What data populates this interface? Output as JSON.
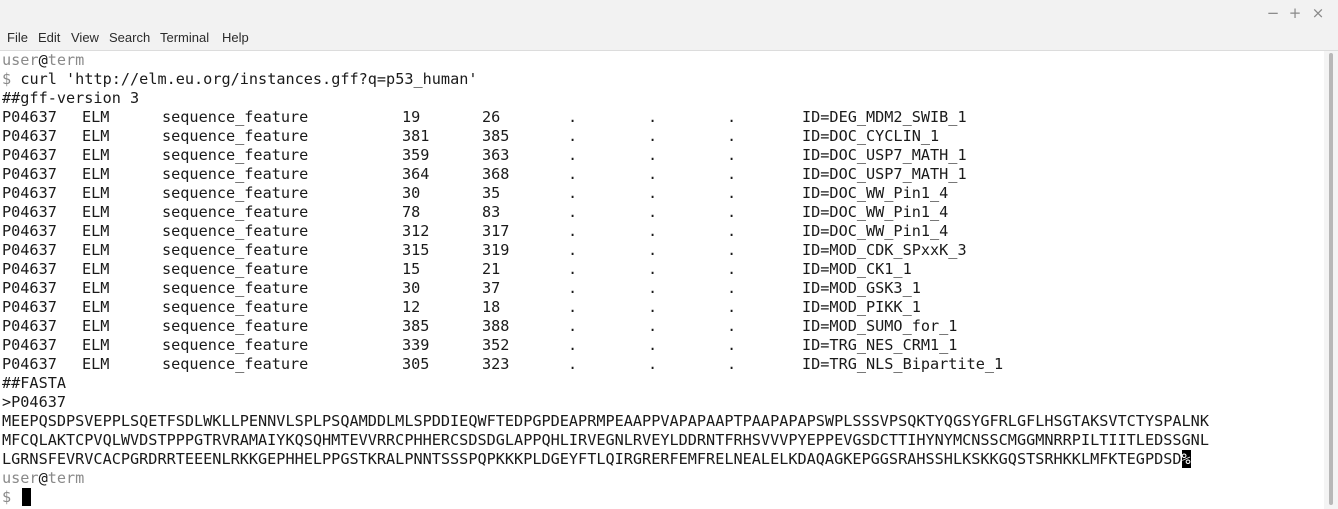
{
  "window": {
    "controls": {
      "minimize": "−",
      "maximize": "+",
      "close": "×"
    }
  },
  "menu": [
    "File",
    "Edit",
    "View",
    "Search",
    "Terminal",
    "Help"
  ],
  "terminal": {
    "prompt_user": "user",
    "prompt_at": "@",
    "prompt_host": "term",
    "prompt_symbol": "$",
    "command": "curl 'http://elm.eu.org/instances.gff?q=p53_human'",
    "gff_header": "##gff-version 3",
    "gff_rows": [
      {
        "seqid": "P04637",
        "source": "ELM",
        "type": "sequence_feature",
        "start": "19",
        "end": "26",
        "score": ".",
        "strand": ".",
        "phase": ".",
        "attr": "ID=DEG_MDM2_SWIB_1"
      },
      {
        "seqid": "P04637",
        "source": "ELM",
        "type": "sequence_feature",
        "start": "381",
        "end": "385",
        "score": ".",
        "strand": ".",
        "phase": ".",
        "attr": "ID=DOC_CYCLIN_1"
      },
      {
        "seqid": "P04637",
        "source": "ELM",
        "type": "sequence_feature",
        "start": "359",
        "end": "363",
        "score": ".",
        "strand": ".",
        "phase": ".",
        "attr": "ID=DOC_USP7_MATH_1"
      },
      {
        "seqid": "P04637",
        "source": "ELM",
        "type": "sequence_feature",
        "start": "364",
        "end": "368",
        "score": ".",
        "strand": ".",
        "phase": ".",
        "attr": "ID=DOC_USP7_MATH_1"
      },
      {
        "seqid": "P04637",
        "source": "ELM",
        "type": "sequence_feature",
        "start": "30",
        "end": "35",
        "score": ".",
        "strand": ".",
        "phase": ".",
        "attr": "ID=DOC_WW_Pin1_4"
      },
      {
        "seqid": "P04637",
        "source": "ELM",
        "type": "sequence_feature",
        "start": "78",
        "end": "83",
        "score": ".",
        "strand": ".",
        "phase": ".",
        "attr": "ID=DOC_WW_Pin1_4"
      },
      {
        "seqid": "P04637",
        "source": "ELM",
        "type": "sequence_feature",
        "start": "312",
        "end": "317",
        "score": ".",
        "strand": ".",
        "phase": ".",
        "attr": "ID=DOC_WW_Pin1_4"
      },
      {
        "seqid": "P04637",
        "source": "ELM",
        "type": "sequence_feature",
        "start": "315",
        "end": "319",
        "score": ".",
        "strand": ".",
        "phase": ".",
        "attr": "ID=MOD_CDK_SPxxK_3"
      },
      {
        "seqid": "P04637",
        "source": "ELM",
        "type": "sequence_feature",
        "start": "15",
        "end": "21",
        "score": ".",
        "strand": ".",
        "phase": ".",
        "attr": "ID=MOD_CK1_1"
      },
      {
        "seqid": "P04637",
        "source": "ELM",
        "type": "sequence_feature",
        "start": "30",
        "end": "37",
        "score": ".",
        "strand": ".",
        "phase": ".",
        "attr": "ID=MOD_GSK3_1"
      },
      {
        "seqid": "P04637",
        "source": "ELM",
        "type": "sequence_feature",
        "start": "12",
        "end": "18",
        "score": ".",
        "strand": ".",
        "phase": ".",
        "attr": "ID=MOD_PIKK_1"
      },
      {
        "seqid": "P04637",
        "source": "ELM",
        "type": "sequence_feature",
        "start": "385",
        "end": "388",
        "score": ".",
        "strand": ".",
        "phase": ".",
        "attr": "ID=MOD_SUMO_for_1"
      },
      {
        "seqid": "P04637",
        "source": "ELM",
        "type": "sequence_feature",
        "start": "339",
        "end": "352",
        "score": ".",
        "strand": ".",
        "phase": ".",
        "attr": "ID=TRG_NES_CRM1_1"
      },
      {
        "seqid": "P04637",
        "source": "ELM",
        "type": "sequence_feature",
        "start": "305",
        "end": "323",
        "score": ".",
        "strand": ".",
        "phase": ".",
        "attr": "ID=TRG_NLS_Bipartite_1"
      }
    ],
    "fasta_header": "##FASTA",
    "fasta_id": ">P04637",
    "sequence_lines": [
      "MEEPQSDPSVEPPLSQETFSDLWKLLPENNVLSPLPSQAMDDLMLSPDDIEQWFTEDPGPDEAPRMPEAAPPVAPAPAAPTPAAPAPAPSWPLSSSVPSQKTYQGSYGFRLGFLHSGTAKSVTCTYSPALNK",
      "MFCQLAKTCPVQLWVDSTPPPGTRVRAMAIYKQSQHMTEVVRRCPHHERCSDSDGLAPPQHLIRVEGNLRVEYLDDRNTFRHSVVVPYEPPEVGSDCTTIHYNYMCNSSCMGGMNRRPILTIITLEDSSGNL",
      "LGRNSFEVRVCACPGRDRRTEEENLRKKGEPHHELPPGSTKRALPNNTSSSPQPKKKPLDGEYFTLQIRGRERFEMFRELNEALELKDAQAGKEPGGSRAHSSHLKSKKGQSTSRHKKLMFKTEGPDSD"
    ],
    "sequence_last_char": "%"
  },
  "colors": {
    "text": "#1a1a1a",
    "prompt_dim": "#8a8a8a",
    "background": "#ffffff",
    "chrome": "#f2f2f2"
  }
}
